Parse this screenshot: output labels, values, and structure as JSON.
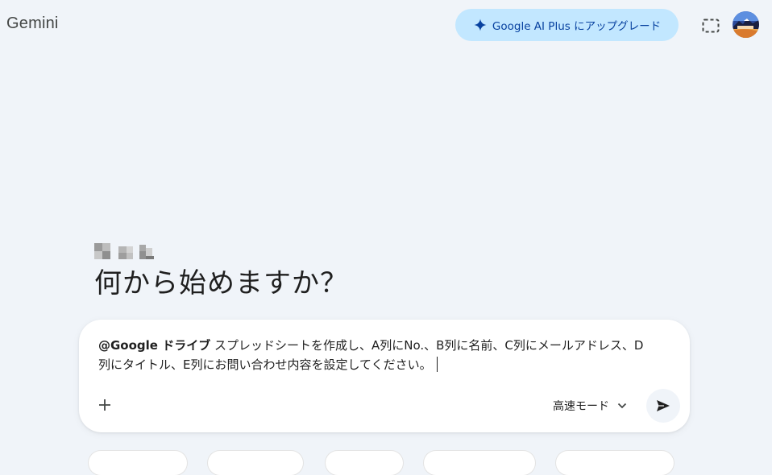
{
  "header": {
    "app_title": "Gemini",
    "upgrade_label": "Google AI Plus にアップグレード",
    "upgrade_icon": "sparkle-icon",
    "screenshot_icon": "screen-capture-icon",
    "avatar_icon": "avatar"
  },
  "greeting": {
    "name_pixelated": true,
    "headline": "何から始めますか？"
  },
  "prompt": {
    "mention": "@Google ドライブ",
    "text": " スプレッドシートを作成し、A列にNo.、B列に名前、C列にメールアドレス、D列にタイトル、E列にお問い合わせ内容を設定してください。",
    "mode_label": "高速モード",
    "add_icon": "plus-icon",
    "send_icon": "send-icon",
    "mode_icon": "chevron-down-icon"
  },
  "colors": {
    "background": "#f0f4f9",
    "upgrade_bg": "#c2e7ff",
    "upgrade_text": "#0842a0",
    "input_bg": "#ffffff"
  }
}
